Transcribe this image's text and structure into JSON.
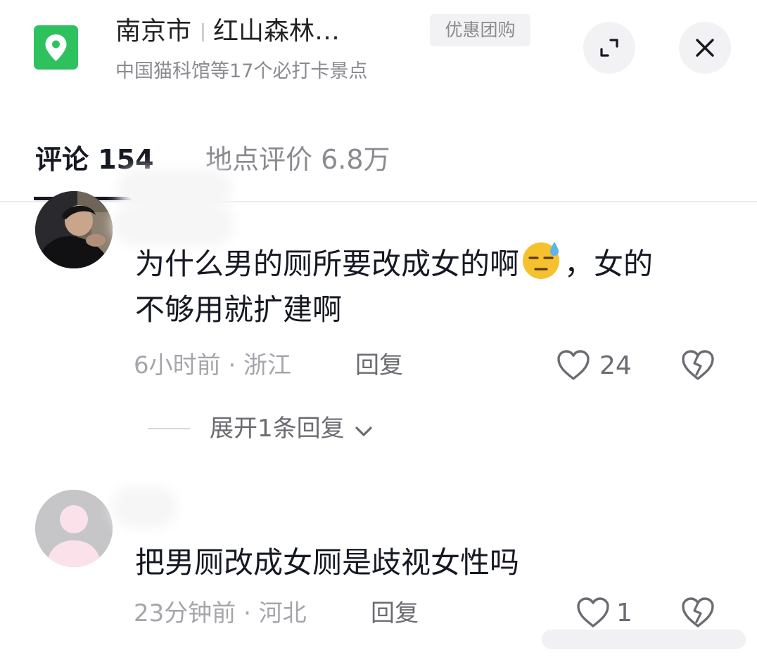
{
  "header": {
    "city": "南京市",
    "place": "红山森林…",
    "subtitle": "中国猫科馆等17个必打卡景点",
    "tag": "优惠团购",
    "map_icon": "map-pin-icon",
    "brand_color": "#2ec25e"
  },
  "tabs": [
    {
      "label": "评论 154",
      "active": true
    },
    {
      "label": "地点评价 6.8万",
      "active": false
    }
  ],
  "comments": [
    {
      "text_part1": "为什么男的厕所要改成女的啊",
      "emoji": "sweat-face-emoji",
      "text_part2": "，女的",
      "text_line2": "不够用就扩建啊",
      "time_location": "6小时前 · 浙江",
      "reply_label": "回复",
      "likes": "24",
      "expand_label": "展开1条回复"
    },
    {
      "text": "把男厕改成女厕是歧视女性吗",
      "time_location": "23分钟前 · 河北",
      "reply_label": "回复",
      "likes": "1"
    }
  ]
}
